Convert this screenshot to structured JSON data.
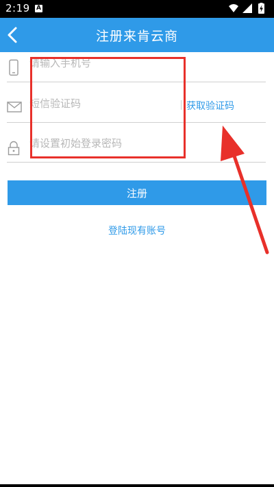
{
  "status_bar": {
    "time": "2:19",
    "notification_badge": "A",
    "icons": [
      "wifi-icon",
      "signal-icon",
      "battery-charging-icon"
    ]
  },
  "header": {
    "title": "注册来肯云商",
    "back_icon": "chevron-left-icon",
    "background": "#2f9ae8"
  },
  "form": {
    "phone": {
      "placeholder": "请输入手机号",
      "value": "",
      "icon": "phone-icon"
    },
    "sms_code": {
      "placeholder": "短信验证码",
      "value": "",
      "icon": "mail-icon",
      "get_code_label": "获取验证码"
    },
    "password": {
      "placeholder": "请设置初始登录密码",
      "value": "",
      "icon": "lock-icon"
    }
  },
  "register_button": {
    "label": "注册"
  },
  "login_link": {
    "label": "登陆现有账号"
  },
  "colors": {
    "accent": "#2f9ae8",
    "annotation": "#e8302a"
  }
}
